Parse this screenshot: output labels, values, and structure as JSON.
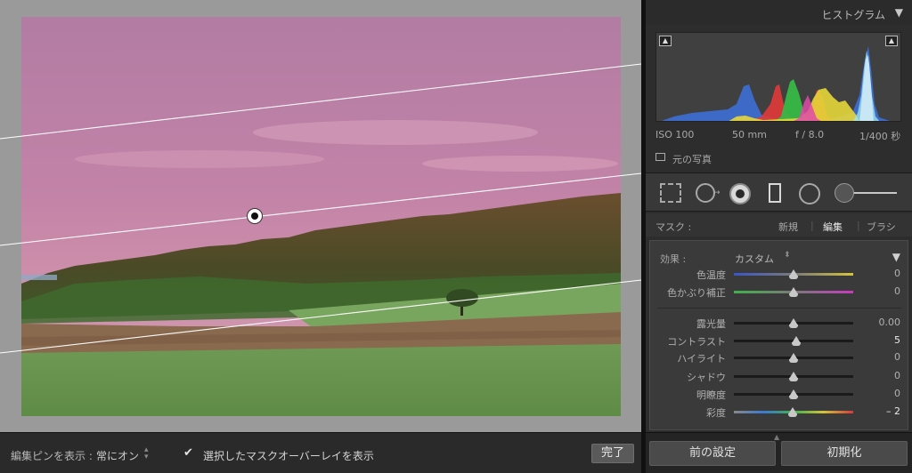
{
  "toolbar": {
    "pin_label": "編集ピンを表示 :",
    "pin_value": "常にオン",
    "overlay_label": "選択したマスクオーバーレイを表示",
    "overlay_checked": true,
    "done_label": "完了"
  },
  "histogram": {
    "title": "ヒストグラム",
    "iso": "ISO 100",
    "focal": "50 mm",
    "aperture": "f / 8.0",
    "shutter": "1/400 秒",
    "original_label": "元の写真"
  },
  "tools": {
    "icons": [
      "crop-icon",
      "spot-removal-icon",
      "red-eye-icon",
      "graduated-filter-icon",
      "radial-filter-icon",
      "adjustment-brush-icon"
    ]
  },
  "mask": {
    "label": "マスク :",
    "new": "新規",
    "edit": "編集",
    "brush": "ブラシ"
  },
  "effects": {
    "label": "効果 :",
    "value": "カスタム",
    "sliders": [
      {
        "label": "色温度",
        "value": "0",
        "level": 0.5,
        "track": "temp"
      },
      {
        "label": "色かぶり補正",
        "value": "0",
        "level": 0.5,
        "track": "tint"
      },
      {
        "label": "露光量",
        "value": "0.00",
        "level": 0.5,
        "track": "plain"
      },
      {
        "label": "コントラスト",
        "value": "5",
        "level": 0.525,
        "track": "plain"
      },
      {
        "label": "ハイライト",
        "value": "0",
        "level": 0.5,
        "track": "plain"
      },
      {
        "label": "シャドウ",
        "value": "0",
        "level": 0.5,
        "track": "plain"
      },
      {
        "label": "明瞭度",
        "value": "0",
        "level": 0.5,
        "track": "plain"
      },
      {
        "label": "彩度",
        "value": "– 2",
        "level": 0.49,
        "track": "sat"
      }
    ]
  },
  "buttons": {
    "previous": "前の設定",
    "reset": "初期化"
  },
  "colors": {
    "sky_overlay": "#c07fa6",
    "accent": "#e8e8e8"
  }
}
